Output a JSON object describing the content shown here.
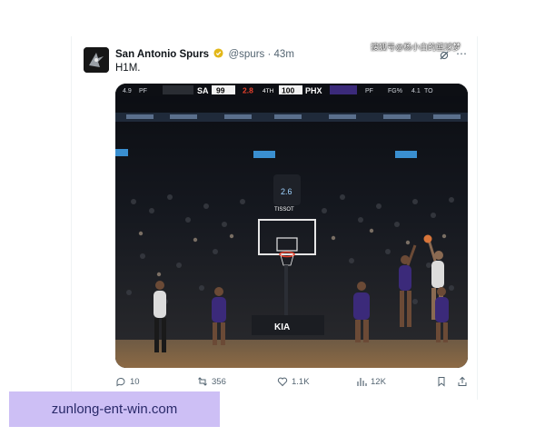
{
  "tweet": {
    "author_name": "San Antonio Spurs",
    "handle": "@spurs",
    "separator": "·",
    "time": "43m",
    "text": "H1M."
  },
  "watermark": "搜狐号@杨小白的篮球梦",
  "scoreboard": {
    "left_stat_label": "PF",
    "left_stat_value": "4.9",
    "home_team": "SA",
    "home_score": "99",
    "clock": "2.8",
    "quarter": "4TH",
    "away_score": "100",
    "away_team": "PHX",
    "right_stat_label": "PF",
    "fg_label": "FG%",
    "fg_value": "4.1",
    "to_label": "TO"
  },
  "arena": {
    "shot_clock": "2.6",
    "sponsor_top": "TISSOT",
    "sponsor_bottom": "KIA"
  },
  "actions": {
    "replies": "10",
    "reposts": "356",
    "likes": "1.1K",
    "views": "12K"
  },
  "banner": {
    "text": "zunlong-ent-win.com"
  },
  "colors": {
    "verified_badge": "#e2b719",
    "banner_bg": "#cdbff5",
    "suns_purple": "#3b2a7a",
    "court": "#8c6a45"
  }
}
